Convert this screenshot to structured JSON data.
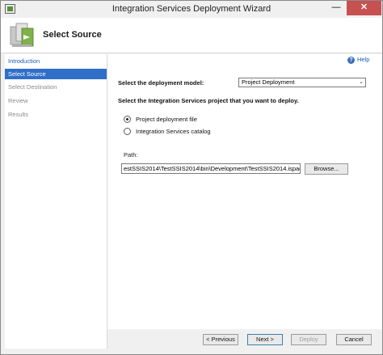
{
  "window": {
    "title": "Integration Services Deployment Wizard",
    "minimize_glyph": "—",
    "close_glyph": "✕"
  },
  "header": {
    "title": "Select Source",
    "icon": "wizard-graphic-icon"
  },
  "sidebar": {
    "items": [
      {
        "label": "Introduction",
        "state": "link"
      },
      {
        "label": "Select Source",
        "state": "selected"
      },
      {
        "label": "Select Destination",
        "state": "disabled"
      },
      {
        "label": "Review",
        "state": "disabled"
      },
      {
        "label": "Results",
        "state": "disabled"
      }
    ]
  },
  "main": {
    "help_label": "Help",
    "help_glyph": "?",
    "deployment_model_label": "Select the deployment model:",
    "deployment_model_value": "Project Deployment",
    "select_arrow": "⌄",
    "project_prompt": "Select the Integration Services project that you want to deploy.",
    "options": [
      {
        "label": "Project deployment file",
        "checked": true
      },
      {
        "label": "Integration Services catalog",
        "checked": false
      }
    ],
    "path_label": "Path:",
    "path_value": "estSSIS2014\\TestSSIS2014\\bin\\Development\\TestSSIS2014.ispac",
    "browse_label": "Browse..."
  },
  "footer": {
    "previous_label": "< Previous",
    "next_label": "Next >",
    "deploy_label": "Deploy",
    "cancel_label": "Cancel"
  },
  "colors": {
    "selection": "#2f6fc9",
    "link": "#1a5fb4",
    "close_button": "#c75050"
  }
}
